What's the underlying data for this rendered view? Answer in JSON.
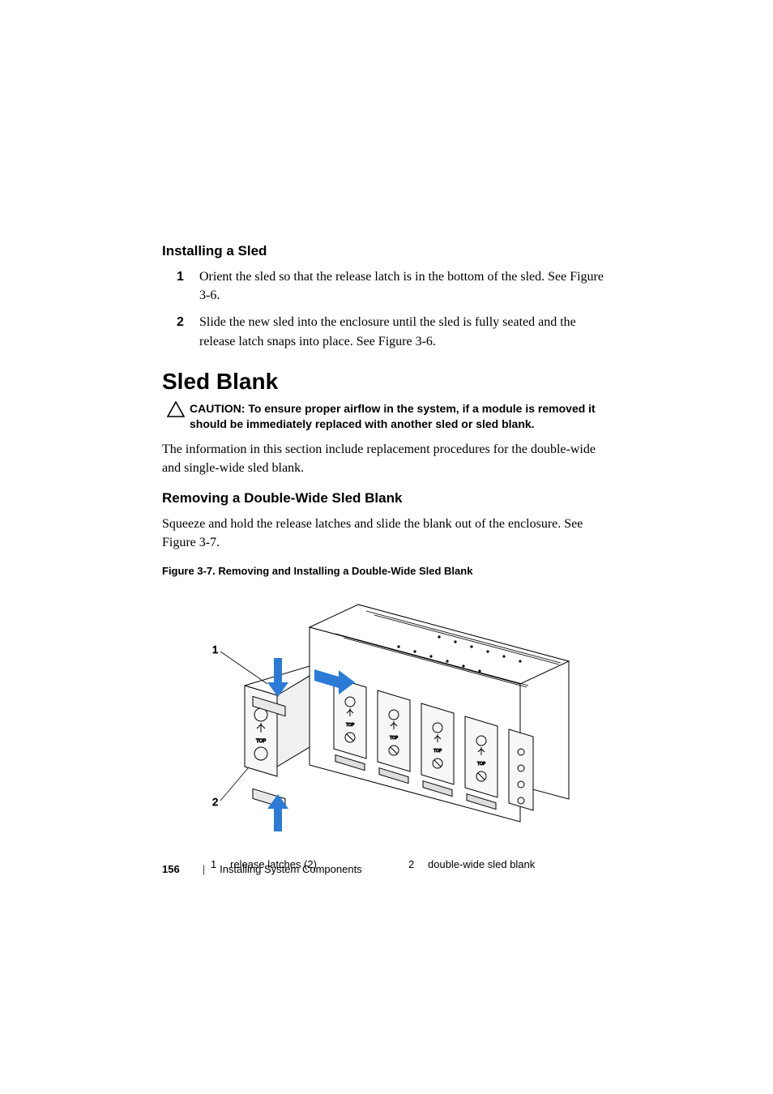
{
  "section1": {
    "heading": "Installing a Sled",
    "steps": [
      {
        "num": "1",
        "text": "Orient the sled so that the release latch is in the bottom of the sled. See Figure 3-6."
      },
      {
        "num": "2",
        "text": "Slide the new sled into the enclosure until the sled is fully seated and the release latch snaps into place. See Figure 3-6."
      }
    ]
  },
  "section2": {
    "heading": "Sled Blank",
    "caution_label": "CAUTION: ",
    "caution_text": "To ensure proper airflow in the system, if a module is removed it should be immediately replaced with another sled or sled blank.",
    "para": "The information in this section include replacement procedures for the double-wide and single-wide sled blank."
  },
  "section3": {
    "heading": "Removing a Double-Wide Sled Blank",
    "para": "Squeeze and hold the release latches and slide the blank out of the enclosure. See Figure 3-7."
  },
  "figure": {
    "caption": "Figure 3-7.    Removing and Installing a Double-Wide Sled Blank",
    "callouts": [
      {
        "num": "1",
        "label": "release latches (2)"
      },
      {
        "num": "2",
        "label": "double-wide sled blank"
      }
    ],
    "leader1": "1",
    "leader2": "2"
  },
  "footer": {
    "page": "156",
    "sep": "|",
    "title": "Installing System Components"
  }
}
